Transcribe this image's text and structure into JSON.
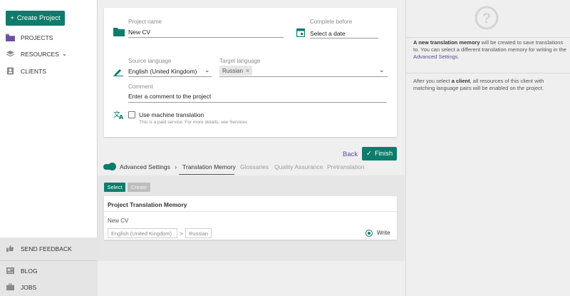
{
  "sidebar": {
    "create_project": "Create Project",
    "items": [
      {
        "label": "PROJECTS",
        "icon": "folder-icon"
      },
      {
        "label": "RESOURCES",
        "icon": "layers-icon"
      },
      {
        "label": "CLIENTS",
        "icon": "contact-card-icon"
      }
    ],
    "bottom": [
      {
        "label": "SEND FEEDBACK",
        "icon": "thumbs-icon"
      },
      {
        "label": "BLOG",
        "icon": "newspaper-icon"
      },
      {
        "label": "JOBS",
        "icon": "briefcase-icon"
      }
    ]
  },
  "form": {
    "project_name_label": "Project name",
    "project_name_value": "New CV",
    "complete_before_label": "Complete before",
    "complete_before_value": "Select a date",
    "source_language_label": "Source language",
    "source_language_value": "English (United Kingdom)",
    "target_language_label": "Target language",
    "target_language_chip": "Russian",
    "comment_label": "Comment",
    "comment_value": "Enter a comment to the project",
    "mt_label": "Use machine translation",
    "mt_note": "This is a paid service. For more details, see Services"
  },
  "actions": {
    "back": "Back",
    "finish": "Finish"
  },
  "tabs": {
    "advanced_settings": "Advanced Settings",
    "items": [
      "Translation Memory",
      "Glossaries",
      "Quality Assurance",
      "Pretranslation"
    ]
  },
  "tm": {
    "select": "Select",
    "create": "Create",
    "header": "Project Translation Memory",
    "name": "New CV",
    "source": "English (United Kingdom)",
    "arrow": ">",
    "target": "Russian",
    "mode": "Write"
  },
  "right_panel": {
    "p1_bold": "A new translation memory",
    "p1_text": " will be created to save translations to. You can select a different translation memory for writing in the ",
    "p1_link": "Advanced Settings",
    "p1_end": ".",
    "p2_start": "After you select ",
    "p2_bold": "a client",
    "p2_text": ", all resources of this client with matching language pairs will be enabled on the project."
  },
  "colors": {
    "accent": "#0e7c6c",
    "link": "#5a4a9a",
    "folder": "#6b4fa0"
  }
}
